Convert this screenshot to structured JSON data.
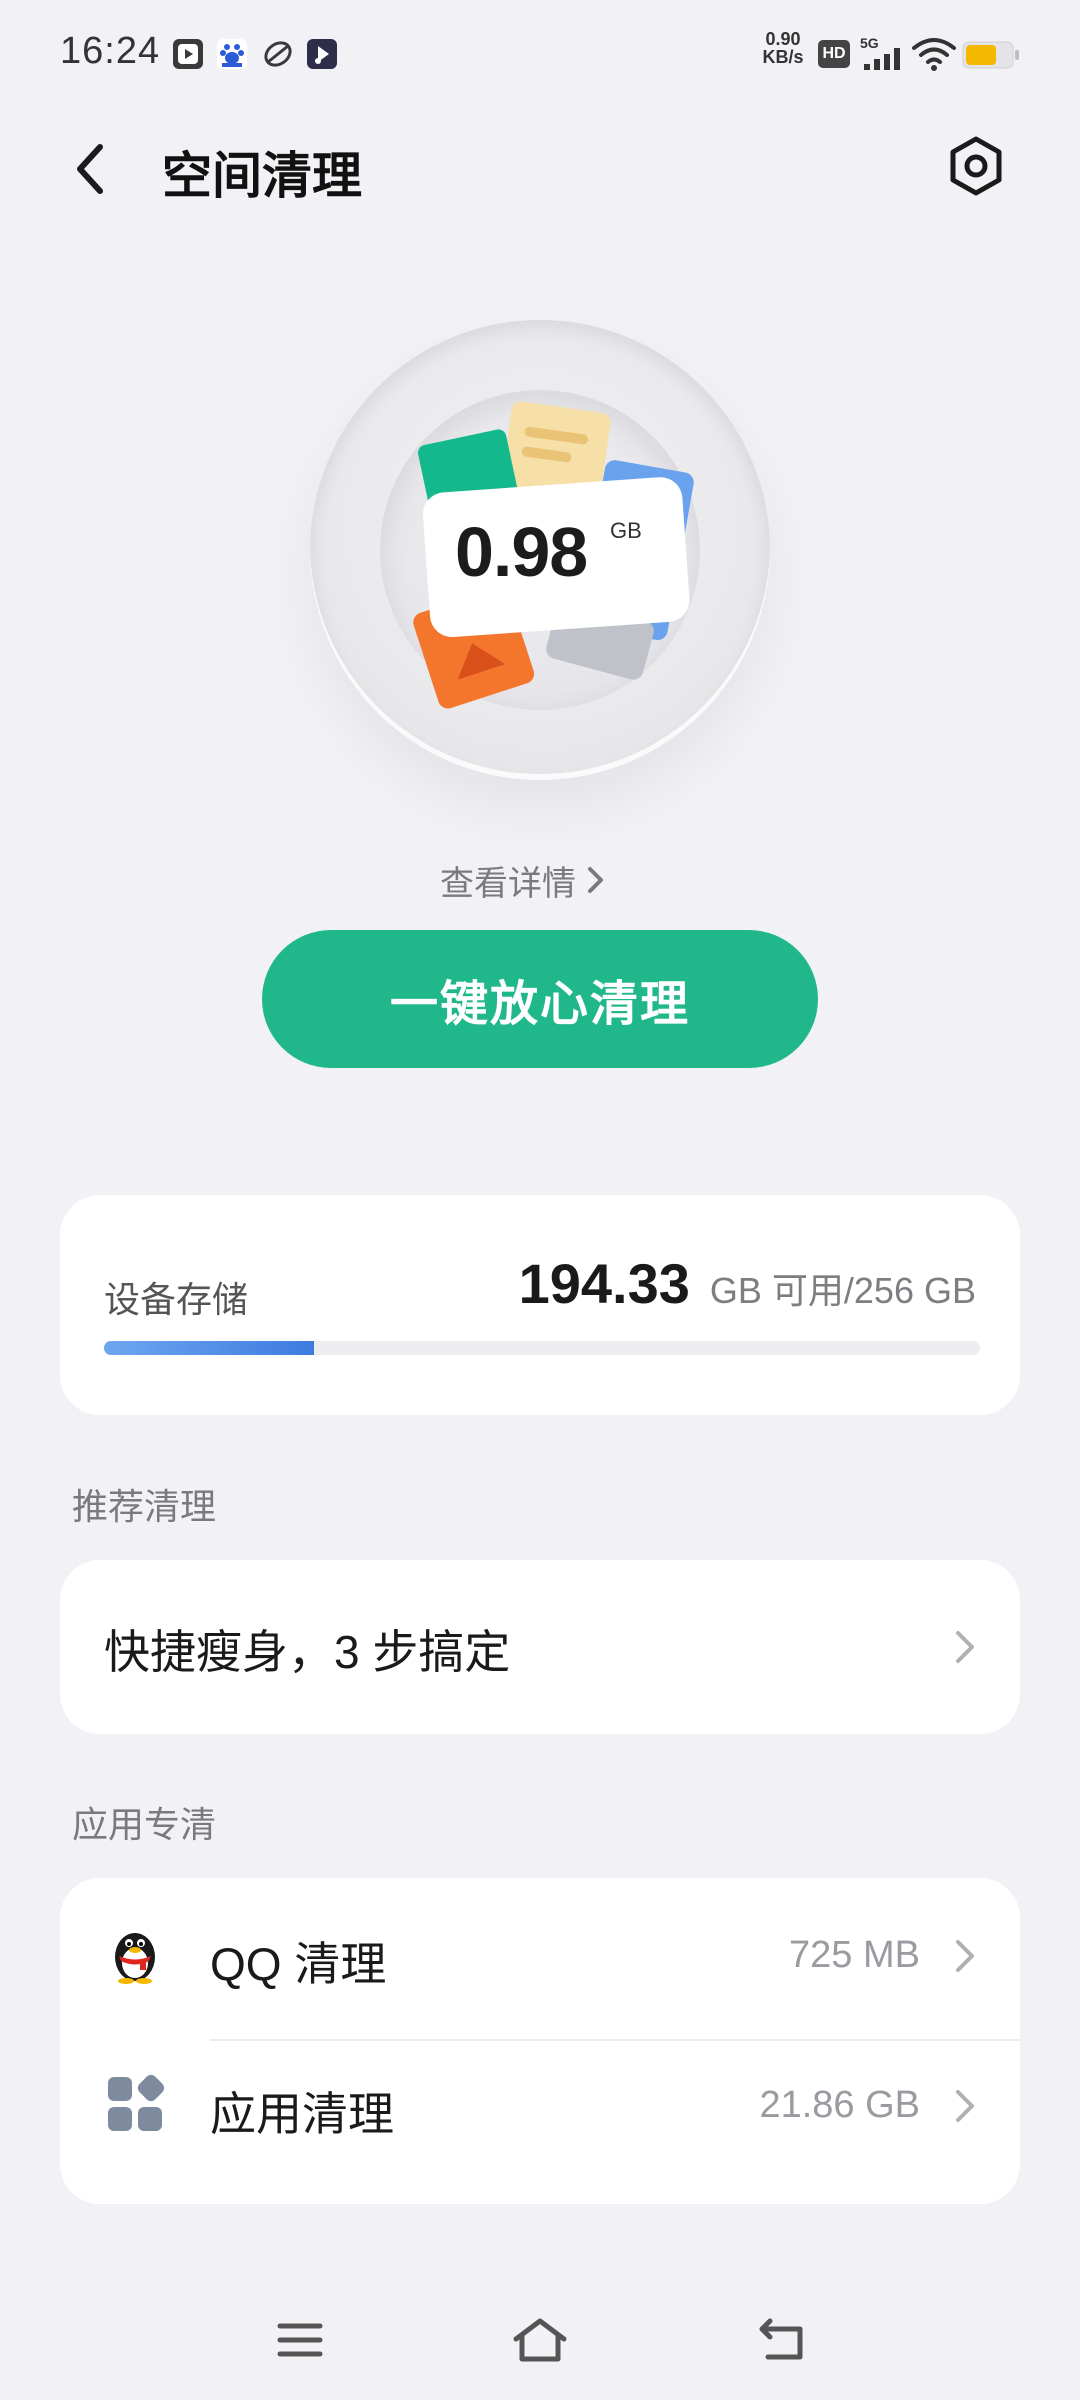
{
  "status_bar": {
    "time": "16:24",
    "network_speed_value": "0.90",
    "network_speed_unit": "KB/s",
    "hd_label": "HD",
    "network_type": "5G",
    "battery_color": "#f5b800"
  },
  "header": {
    "title": "空间清理"
  },
  "hero": {
    "value": "0.98",
    "unit": "GB"
  },
  "view_details": "查看详情",
  "clean_button": "一键放心清理",
  "storage": {
    "label": "设备存储",
    "available": "194.33",
    "unit_text": "GB 可用/256 GB",
    "used_fraction": 0.24
  },
  "recommend": {
    "section_label": "推荐清理",
    "tip": "快捷瘦身，3 步搞定"
  },
  "apps": {
    "section_label": "应用专清",
    "items": [
      {
        "name": "QQ 清理",
        "size": "725 MB",
        "icon": "qq-penguin-icon"
      },
      {
        "name": "应用清理",
        "size": "21.86 GB",
        "icon": "apps-grid-icon"
      }
    ]
  },
  "accent_color": "#20b88a"
}
